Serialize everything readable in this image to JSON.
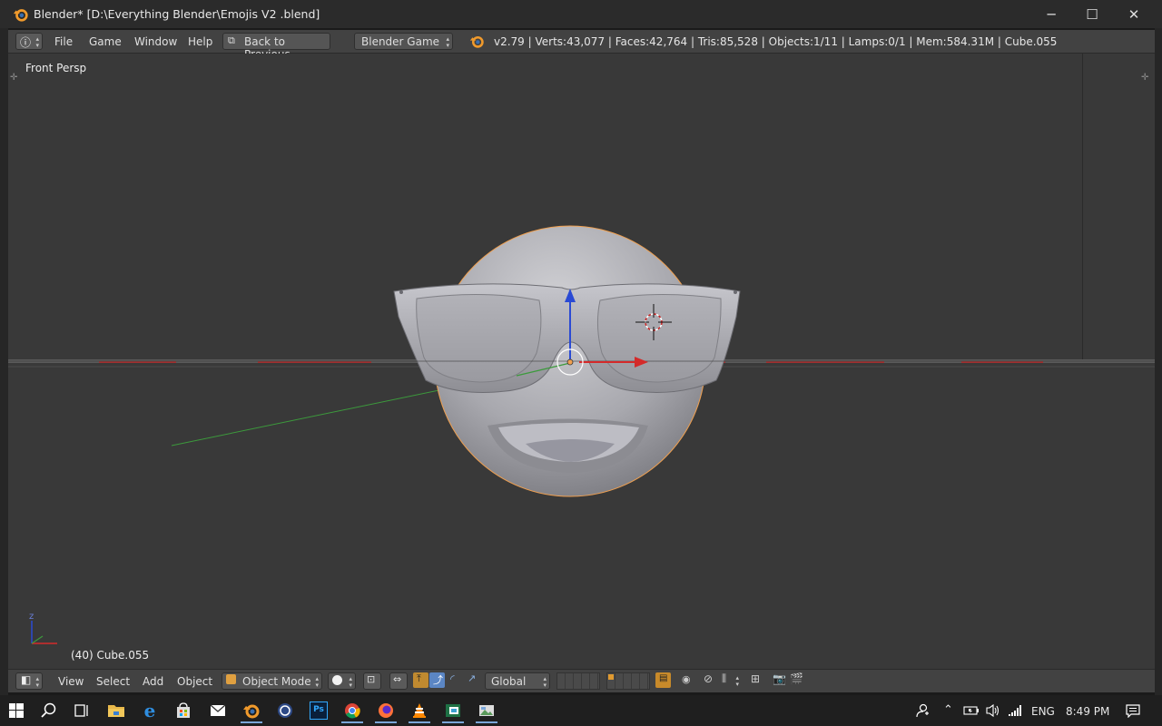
{
  "window": {
    "title": "Blender* [D:\\Everything Blender\\Emojis V2 .blend]",
    "minimize_glyph": "─",
    "maximize_glyph": "☐",
    "close_glyph": "✕"
  },
  "info_header": {
    "menus": [
      "File",
      "Game",
      "Window",
      "Help"
    ],
    "back_button": "Back to Previous",
    "engine": "Blender Game",
    "stats": "v2.79 | Verts:43,077 | Faces:42,764 | Tris:85,528 | Objects:1/11 | Lamps:0/1 | Mem:584.31M | Cube.055"
  },
  "viewport": {
    "view_name": "Front Persp",
    "object_info": "(40) Cube.055",
    "axis_z_label": "z"
  },
  "view3d_header": {
    "menus": [
      "View",
      "Select",
      "Add",
      "Object"
    ],
    "mode": "Object Mode",
    "orientation": "Global"
  },
  "taskbar": {
    "language": "ENG",
    "time": "8:49 PM"
  },
  "colors": {
    "viewport_bg": "#393939",
    "header_bg": "#424242",
    "accent": "#f09a2c",
    "x_axis": "#d42a2a",
    "y_axis": "#2a9a2a",
    "z_axis": "#2a4ad4"
  }
}
